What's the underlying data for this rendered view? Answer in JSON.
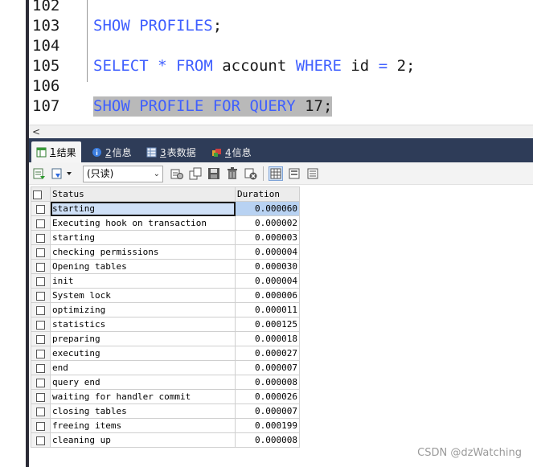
{
  "editor": {
    "lines": [
      {
        "num": "102",
        "tokens": []
      },
      {
        "num": "103",
        "tokens": [
          {
            "t": "kw",
            "v": "SHOW PROFILES"
          },
          {
            "t": "id",
            "v": ";"
          }
        ]
      },
      {
        "num": "104",
        "tokens": []
      },
      {
        "num": "105",
        "tokens": [
          {
            "t": "kw",
            "v": "SELECT"
          },
          {
            "t": "id",
            "v": " "
          },
          {
            "t": "kw",
            "v": "*"
          },
          {
            "t": "id",
            "v": " "
          },
          {
            "t": "kw",
            "v": "FROM"
          },
          {
            "t": "id",
            "v": " account "
          },
          {
            "t": "kw",
            "v": "WHERE"
          },
          {
            "t": "id",
            "v": " id "
          },
          {
            "t": "kw",
            "v": "="
          },
          {
            "t": "id",
            "v": " 2;"
          }
        ]
      },
      {
        "num": "106",
        "tokens": []
      },
      {
        "num": "107",
        "tokens": [
          {
            "t": "kw",
            "v": "SHOW PROFILE FOR QUERY"
          },
          {
            "t": "id",
            "v": " 17;"
          }
        ],
        "highlighted": true
      }
    ],
    "hscroll_arrow": "<"
  },
  "tabs": [
    {
      "num": "1",
      "label": "结果",
      "icon": "result-grid-icon",
      "active": true
    },
    {
      "num": "2",
      "label": "信息",
      "icon": "info-icon",
      "active": false
    },
    {
      "num": "3",
      "label": "表数据",
      "icon": "table-data-icon",
      "active": false
    },
    {
      "num": "4",
      "label": "信息",
      "icon": "info-message-icon",
      "active": false
    }
  ],
  "toolbar": {
    "mode_select": "(只读)",
    "icons": [
      "export-icon",
      "import-dropdown-icon",
      "copy-rows-icon",
      "duplicate-icon",
      "save-icon",
      "delete-icon",
      "cancel-icon",
      "grid-view-icon",
      "form-view-icon",
      "text-view-icon"
    ]
  },
  "grid": {
    "columns": [
      "Status",
      "Duration"
    ],
    "rows": [
      [
        "starting",
        "0.000060"
      ],
      [
        "Executing hook on transaction",
        "0.000002"
      ],
      [
        "starting",
        "0.000003"
      ],
      [
        "checking permissions",
        "0.000004"
      ],
      [
        "Opening tables",
        "0.000030"
      ],
      [
        "init",
        "0.000004"
      ],
      [
        "System lock",
        "0.000006"
      ],
      [
        "optimizing",
        "0.000011"
      ],
      [
        "statistics",
        "0.000125"
      ],
      [
        "preparing",
        "0.000018"
      ],
      [
        "executing",
        "0.000027"
      ],
      [
        "end",
        "0.000007"
      ],
      [
        "query end",
        "0.000008"
      ],
      [
        "waiting for handler commit",
        "0.000026"
      ],
      [
        "closing tables",
        "0.000007"
      ],
      [
        "freeing items",
        "0.000199"
      ],
      [
        "cleaning up",
        "0.000008"
      ]
    ],
    "selected_row": 0
  },
  "watermark": "CSDN @dzWatching"
}
